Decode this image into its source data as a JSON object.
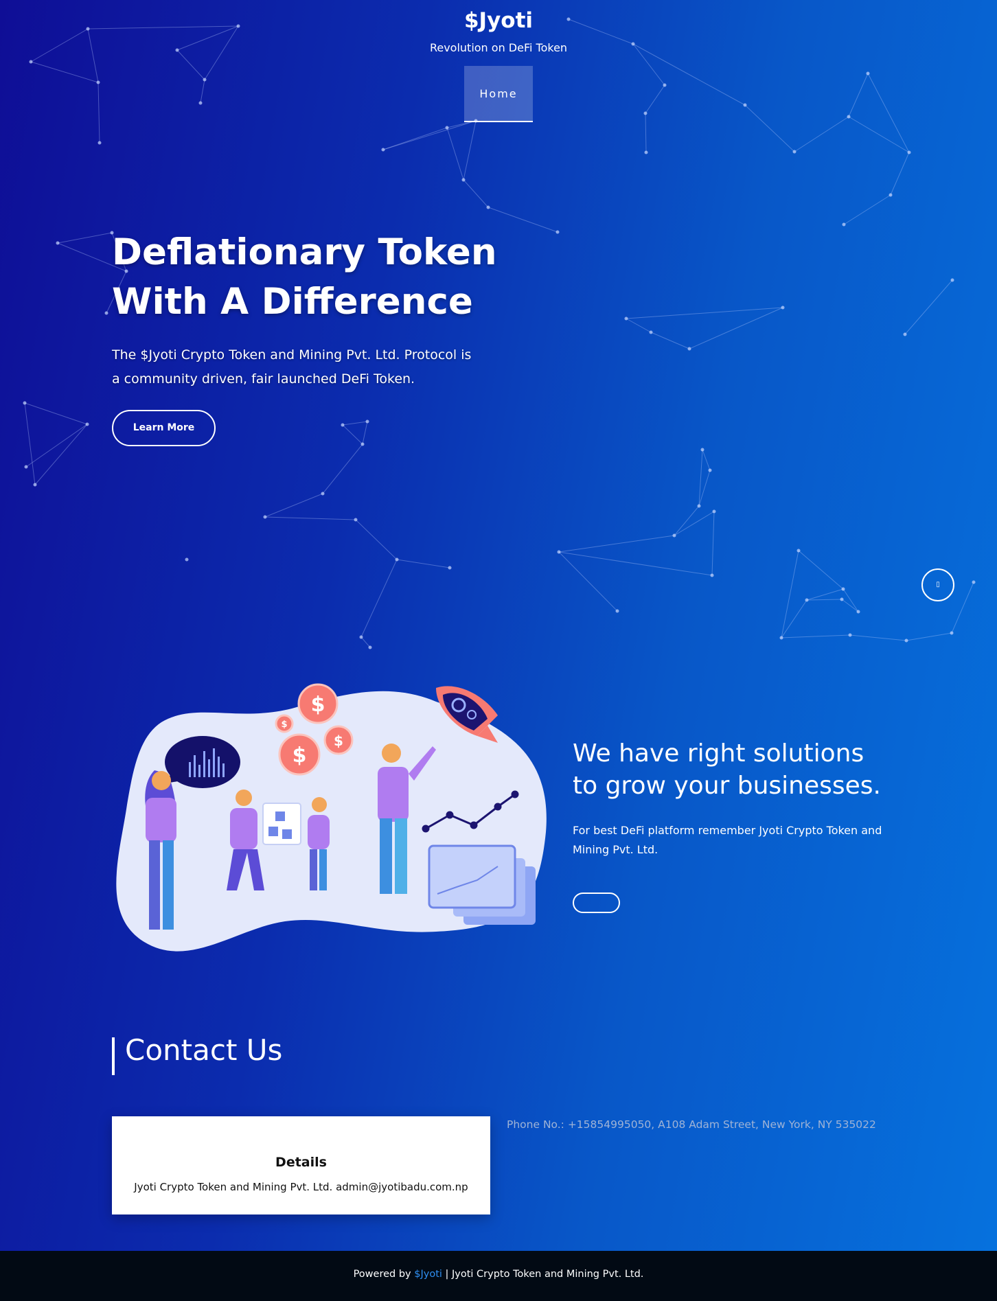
{
  "header": {
    "brand": "$Jyoti",
    "tagline": "Revolution on DeFi Token",
    "nav": [
      {
        "label": "Home",
        "active": true
      }
    ]
  },
  "hero": {
    "title_line1": "Deflationary Token",
    "title_line2": "With A Difference",
    "text_line1": "The $Jyoti Crypto Token and Mining Pvt. Ltd. Protocol is",
    "text_line2": "a community driven, fair launched DeFi Token.",
    "button_label": "Learn More",
    "scroll_button_icon": "chevron-icon"
  },
  "solutions": {
    "title_line1": "We have right solutions",
    "title_line2": "to grow your businesses.",
    "text_line1": "For best DeFi platform remember Jyoti Crypto Token and",
    "text_line2": "Mining Pvt. Ltd.",
    "button_label": ""
  },
  "contact": {
    "title": "Contact Us",
    "details_title": "Details",
    "details_text": "Jyoti Crypto Token and Mining Pvt. Ltd. admin@jyotibadu.com.np",
    "phone": "Phone No.: +15854995050, A108 Adam Street, New York, NY 535022"
  },
  "footer": {
    "prefix": "Powered by",
    "link": "$Jyoti",
    "suffix": "| Jyoti Crypto Token and Mining Pvt. Ltd."
  },
  "colors": {
    "gradient_start": "#0f0e96",
    "gradient_end": "#0672de",
    "footer_bg": "#020a14",
    "footer_link": "#2f8ef0",
    "coin": "#f77a72",
    "figure_purple": "#a36ae8"
  }
}
